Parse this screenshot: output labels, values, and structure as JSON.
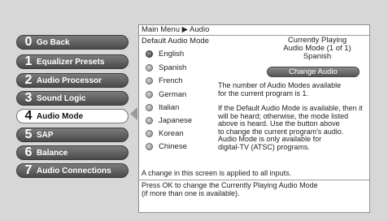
{
  "menu": {
    "items": [
      {
        "num": "0",
        "label": "Go Back",
        "selected": false
      },
      {
        "num": "1",
        "label": "Equalizer Presets",
        "selected": false
      },
      {
        "num": "2",
        "label": "Audio Processor",
        "selected": false
      },
      {
        "num": "3",
        "label": "Sound Logic",
        "selected": false
      },
      {
        "num": "4",
        "label": "Audio Mode",
        "selected": true
      },
      {
        "num": "5",
        "label": "SAP",
        "selected": false
      },
      {
        "num": "6",
        "label": "Balance",
        "selected": false
      },
      {
        "num": "7",
        "label": "Audio Connections",
        "selected": false
      }
    ]
  },
  "panel": {
    "breadcrumb": "Main Menu ▶ Audio",
    "default_title": "Default Audio Mode",
    "languages": [
      "English",
      "Spanish",
      "French",
      "German",
      "Italian",
      "Japanese",
      "Korean",
      "Chinese"
    ],
    "selected_language": "English",
    "currently_playing": {
      "line1": "Currently Playing",
      "line2": "Audio Mode (1 of 1)",
      "line3": "Spanish"
    },
    "change_button": "Change Audio",
    "desc1_line1": "The number of Audio Modes available",
    "desc1_line2": "for the current program is 1.",
    "desc2_lines": [
      "If the Default Audio Mode is available, then it",
      "will be heard; otherwise, the mode listed",
      "above is heard. Use the button above",
      "to change the current program's audio.",
      "Audio Mode is only available for",
      "digital-TV (ATSC) programs."
    ],
    "note": "A change in this screen is applied to all inputs.",
    "footer_line1": "Press OK to change the Currently Playing Audio Mode",
    "footer_line2": "(if more than one is available)."
  }
}
